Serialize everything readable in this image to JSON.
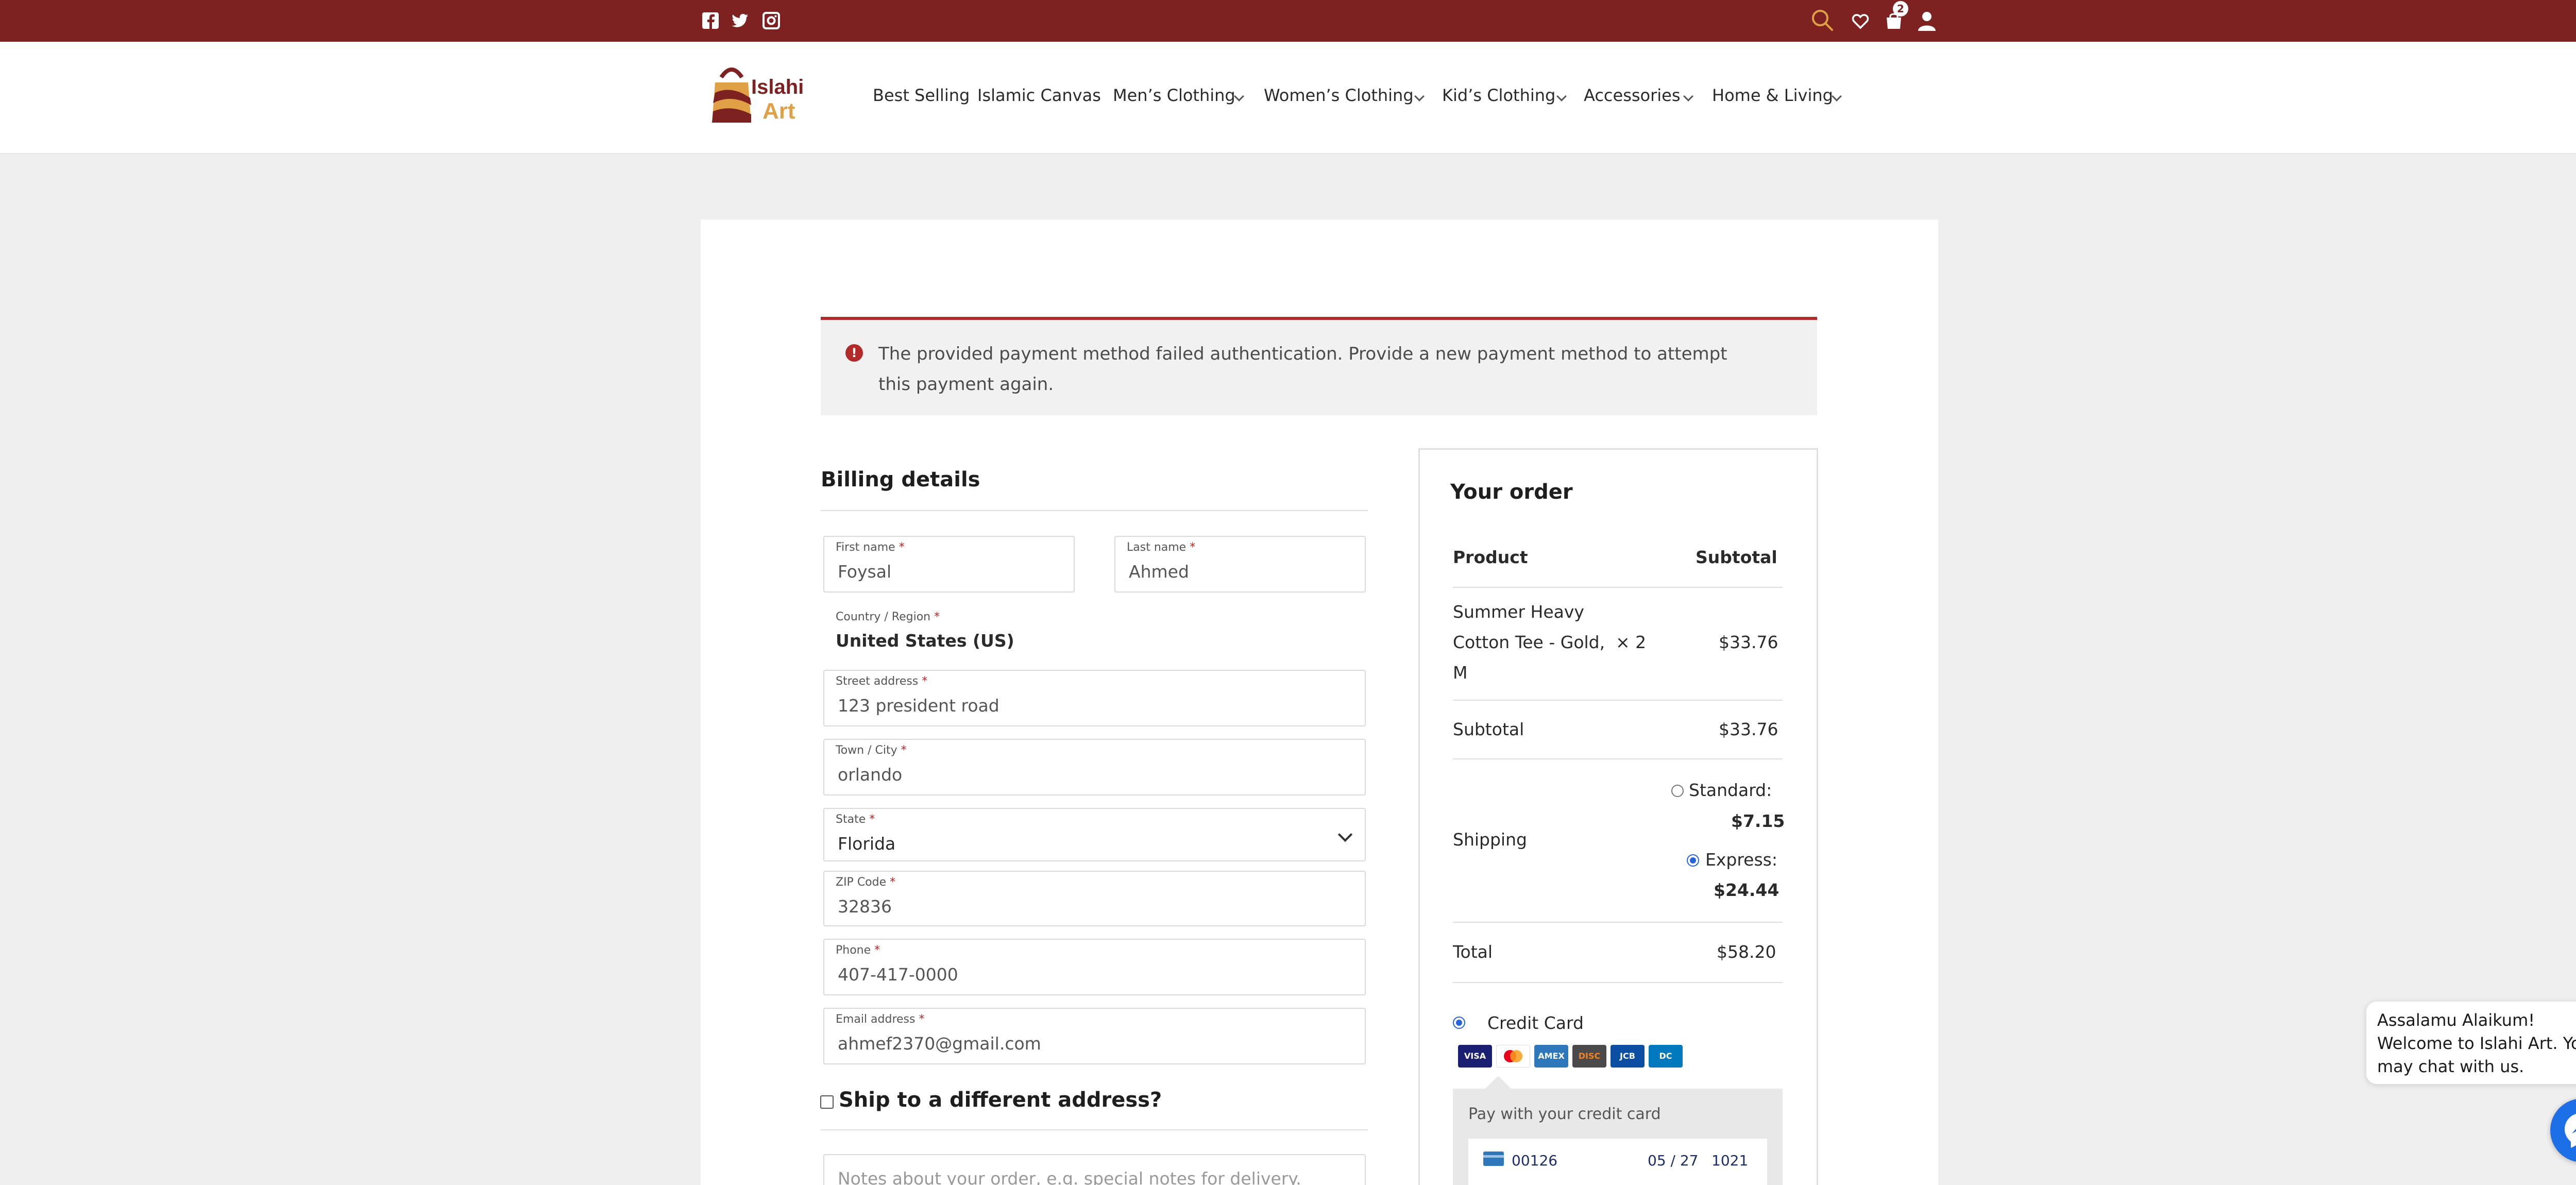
{
  "colors": {
    "brand": "#7e2121",
    "error": "#b32a2a",
    "accent": "#2563d9",
    "messenger": "#1d6fe8"
  },
  "topbar": {
    "social": [
      "facebook-icon",
      "twitter-icon",
      "instagram-icon"
    ],
    "cart_count": "2"
  },
  "header": {
    "logo": {
      "line1": "Islahi",
      "line2": "Art"
    },
    "nav": [
      {
        "label": "Best Selling"
      },
      {
        "label": "Islamic Canvas"
      },
      {
        "label": "Men’s Clothing"
      },
      {
        "label": "Women’s Clothing"
      },
      {
        "label": "Kid’s Clothing"
      },
      {
        "label": "Accessories"
      },
      {
        "label": "Home & Living"
      }
    ]
  },
  "alert": {
    "message": "The provided payment method failed authentication. Provide a new payment method to attempt this payment again."
  },
  "billing": {
    "title": "Billing details",
    "first_name": {
      "label": "First name",
      "value": "Foysal"
    },
    "last_name": {
      "label": "Last name",
      "value": "Ahmed"
    },
    "country": {
      "label": "Country / Region",
      "value": "United States (US)"
    },
    "street": {
      "label": "Street address",
      "value": "123 president road"
    },
    "city": {
      "label": "Town / City",
      "value": "orlando"
    },
    "state": {
      "label": "State",
      "value": "Florida"
    },
    "zip": {
      "label": "ZIP Code",
      "value": "32836"
    },
    "phone": {
      "label": "Phone",
      "value": "407-417-0000"
    },
    "email": {
      "label": "Email address",
      "value": "ahmef2370@gmail.com"
    },
    "required_mark": "*",
    "ship_different": "Ship to a different address?",
    "notes_placeholder": "Notes about your order, e.g. special notes for delivery."
  },
  "order": {
    "title": "Your order",
    "col_product": "Product",
    "col_subtotal": "Subtotal",
    "item": {
      "name_line1": "Summer Heavy",
      "name_line2": "Cotton Tee - Gold,",
      "name_line3": "M",
      "qty": "× 2",
      "price": "$33.76"
    },
    "subtotal_label": "Subtotal",
    "subtotal_value": "$33.76",
    "shipping_label": "Shipping",
    "shipping_options": [
      {
        "label": "Standard:",
        "price": "$7.15",
        "selected": false
      },
      {
        "label": "Express:",
        "price": "$24.44",
        "selected": true
      }
    ],
    "total_label": "Total",
    "total_value": "$58.20"
  },
  "payment": {
    "method_label": "Credit Card",
    "cards": [
      "VISA",
      "MC",
      "AMEX",
      "DISC",
      "JCB",
      "DC"
    ],
    "panel_title": "Pay with your credit card",
    "card_number": "00126",
    "expiry": "05 / 27",
    "cvc": "1021"
  },
  "chat": {
    "message": "Assalamu Alaikum! Welcome to Islahi Art. You may chat with us.",
    "close": "−"
  }
}
